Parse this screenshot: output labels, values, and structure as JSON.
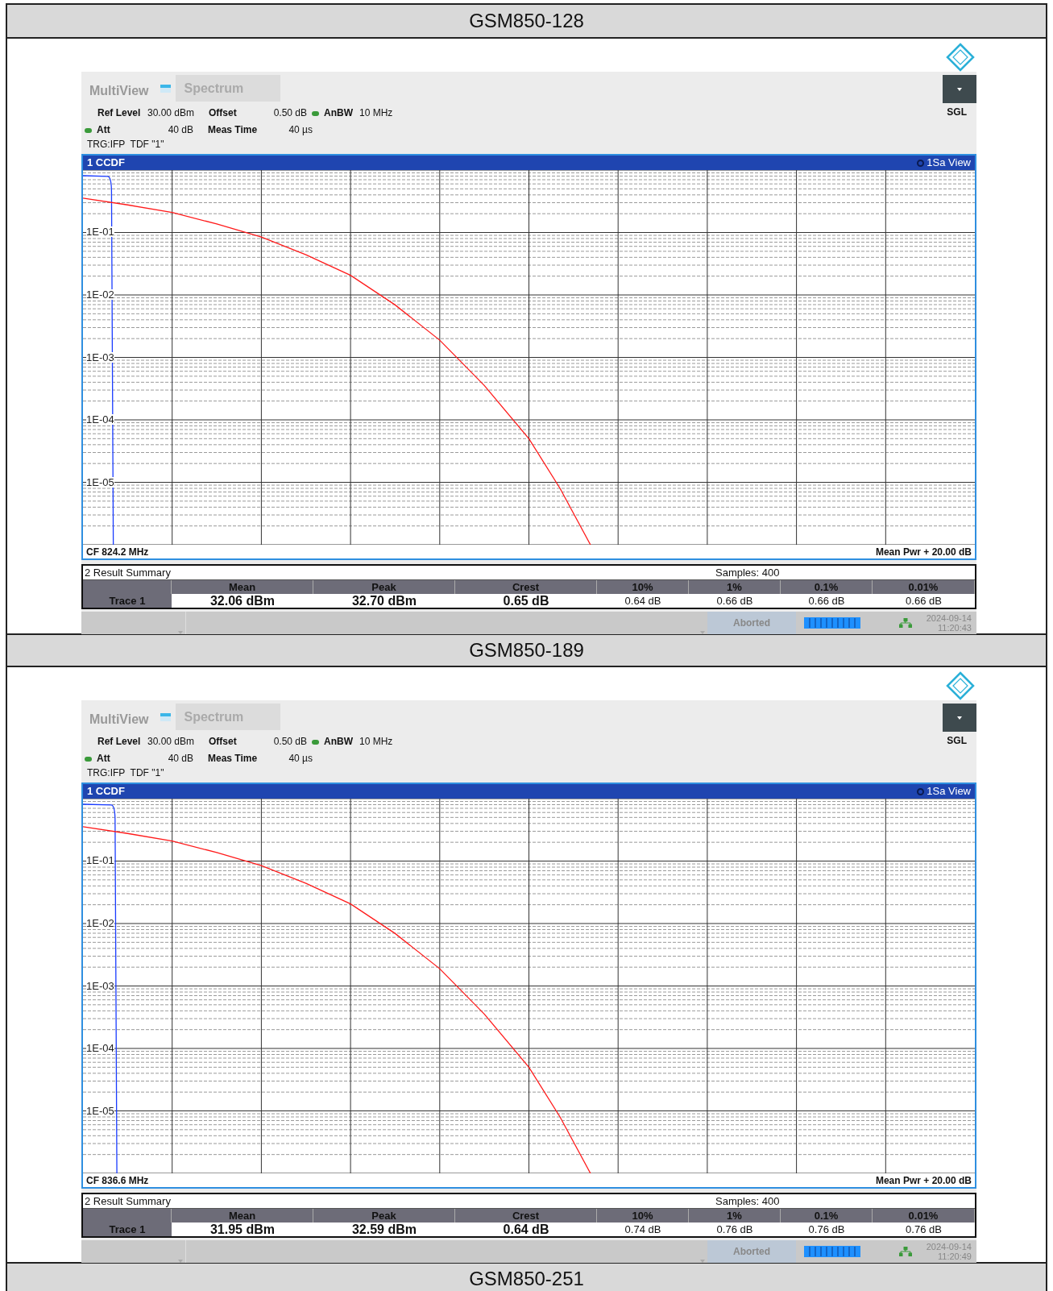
{
  "sections": [
    {
      "title": "GSM850-128",
      "screen": {
        "app_label": "MultiView",
        "tabs": [
          {
            "label": "Spectrum",
            "selected": true
          }
        ],
        "mode": "SGL",
        "settings": [
          [
            {
              "label": "Ref Level",
              "value": "30.00 dBm"
            },
            {
              "label": "Offset",
              "value": "0.50 dB"
            },
            {
              "label": "AnBW",
              "value": "10 MHz"
            }
          ],
          [
            {
              "label": "Att",
              "value": "40 dB"
            },
            {
              "label": "Meas Time",
              "value": "40 µs"
            }
          ]
        ],
        "trigger": "TRG:IFP  TDF \"1\"",
        "chart": {
          "title": "1 CCDF",
          "view": "1Sa View",
          "y_labels": [
            "1E-01",
            "1E-02",
            "1E-03",
            "1E-04",
            "1E-05"
          ],
          "center": "CF 824.2 MHz",
          "span": "Mean Pwr + 20.00 dB"
        },
        "summary": {
          "title": "2 Result Summary",
          "samples": "Samples: 400",
          "columns": [
            "Mean",
            "Peak",
            "Crest",
            "10%",
            "1%",
            "0.1%",
            "0.01%"
          ],
          "row_label": "Trace 1",
          "values": [
            "32.06 dBm",
            "32.70 dBm",
            "0.65 dB",
            "0.64 dB",
            "0.66 dB",
            "0.66 dB",
            "0.66 dB"
          ]
        },
        "status": {
          "state": "Aborted",
          "date": "2024-09-14",
          "time": "11:20:43"
        }
      }
    },
    {
      "title": "GSM850-189",
      "screen": {
        "app_label": "MultiView",
        "tabs": [
          {
            "label": "Spectrum",
            "selected": true
          }
        ],
        "mode": "SGL",
        "settings": [
          [
            {
              "label": "Ref Level",
              "value": "30.00 dBm"
            },
            {
              "label": "Offset",
              "value": "0.50 dB"
            },
            {
              "label": "AnBW",
              "value": "10 MHz"
            }
          ],
          [
            {
              "label": "Att",
              "value": "40 dB"
            },
            {
              "label": "Meas Time",
              "value": "40 µs"
            }
          ]
        ],
        "trigger": "TRG:IFP  TDF \"1\"",
        "chart": {
          "title": "1 CCDF",
          "view": "1Sa View",
          "y_labels": [
            "1E-01",
            "1E-02",
            "1E-03",
            "1E-04",
            "1E-05"
          ],
          "center": "CF 836.6 MHz",
          "span": "Mean Pwr + 20.00 dB"
        },
        "summary": {
          "title": "2 Result Summary",
          "samples": "Samples: 400",
          "columns": [
            "Mean",
            "Peak",
            "Crest",
            "10%",
            "1%",
            "0.1%",
            "0.01%"
          ],
          "row_label": "Trace 1",
          "values": [
            "31.95 dBm",
            "32.59 dBm",
            "0.64 dB",
            "0.74 dB",
            "0.76 dB",
            "0.76 dB",
            "0.76 dB"
          ]
        },
        "status": {
          "state": "Aborted",
          "date": "2024-09-14",
          "time": "11:20:49"
        }
      }
    },
    {
      "title": "GSM850-251"
    }
  ]
}
